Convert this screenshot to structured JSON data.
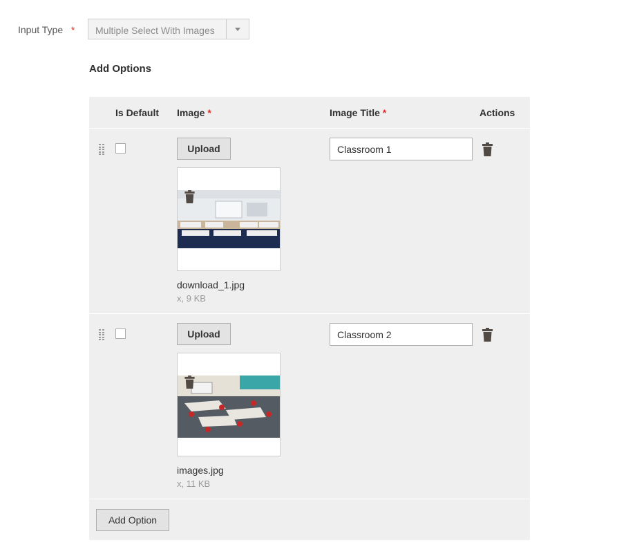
{
  "input_type": {
    "label": "Input Type",
    "required_mark": "*",
    "selected": "Multiple Select With Images"
  },
  "add_options": {
    "title": "Add Options",
    "columns": {
      "is_default": "Is Default",
      "image": "Image",
      "image_title": "Image Title",
      "actions": "Actions",
      "required_mark": "*"
    },
    "upload_label": "Upload",
    "rows": [
      {
        "title": "Classroom 1",
        "file_name": "download_1.jpg",
        "file_meta": "x, 9 KB",
        "is_default": false
      },
      {
        "title": "Classroom 2",
        "file_name": "images.jpg",
        "file_meta": "x, 11 KB",
        "is_default": false
      }
    ],
    "add_option_label": "Add Option"
  },
  "icons": {
    "drag_handle": "drag-handle-icon",
    "delete": "trash-icon",
    "dropdown": "chevron-down-icon"
  },
  "colors": {
    "required": "#e02b27",
    "panel_bg": "#efefef",
    "button_bg": "#e3e3e3"
  }
}
